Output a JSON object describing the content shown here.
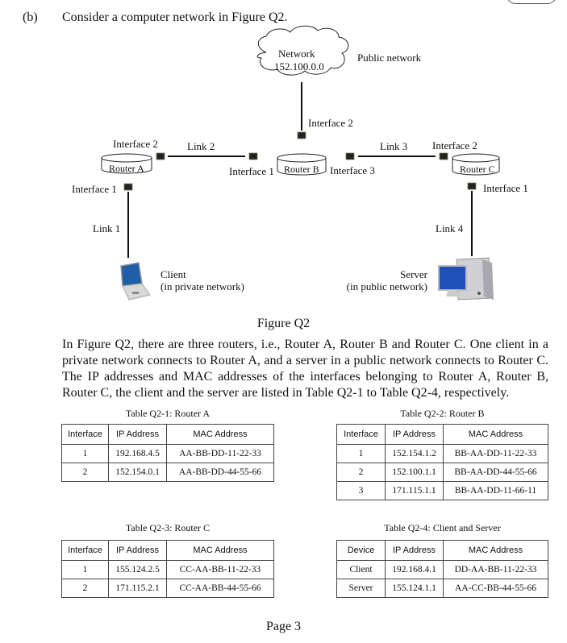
{
  "question": {
    "label": "(b)",
    "prompt": "Consider a computer network in Figure Q2."
  },
  "figure": {
    "caption": "Figure Q2",
    "network_cloud": {
      "line1": "Network",
      "line2": "152.100.0.0"
    },
    "public_network_label": "Public network",
    "routers": {
      "a": {
        "label": "Router A",
        "if1": "Interface 1",
        "if2": "Interface 2"
      },
      "b": {
        "label": "Router B",
        "if1": "Interface 1",
        "if2": "Interface 2",
        "if3": "Interface 3"
      },
      "c": {
        "label": "Router C",
        "if1": "Interface 1",
        "if2": "Interface 2"
      }
    },
    "links": {
      "l1": "Link 1",
      "l2": "Link 2",
      "l3": "Link 3",
      "l4": "Link 4"
    },
    "client": {
      "line1": "Client",
      "line2": "(in private network)"
    },
    "server": {
      "line1": "Server",
      "line2": "(in public network)"
    }
  },
  "paragraph": "In Figure Q2, there are three routers, i.e., Router A, Router B and Router C. One client in a private network connects to Router A, and a server in a public network connects to Router C. The IP addresses and MAC addresses of the interfaces belonging to Router A, Router B, Router C, the client and the server are listed in Table Q2-1 to Table Q2-4, respectively.",
  "tables": {
    "q2_1": {
      "caption": "Table Q2-1: Router A",
      "headers": [
        "Interface",
        "IP Address",
        "MAC Address"
      ],
      "rows": [
        [
          "1",
          "192.168.4.5",
          "AA-BB-DD-11-22-33"
        ],
        [
          "2",
          "152.154.0.1",
          "AA-BB-DD-44-55-66"
        ]
      ]
    },
    "q2_2": {
      "caption": "Table Q2-2: Router B",
      "headers": [
        "Interface",
        "IP Address",
        "MAC Address"
      ],
      "rows": [
        [
          "1",
          "152.154.1.2",
          "BB-AA-DD-11-22-33"
        ],
        [
          "2",
          "152.100.1.1",
          "BB-AA-DD-44-55-66"
        ],
        [
          "3",
          "171.115.1.1",
          "BB-AA-DD-11-66-11"
        ]
      ]
    },
    "q2_3": {
      "caption": "Table Q2-3: Router C",
      "headers": [
        "Interface",
        "IP Address",
        "MAC Address"
      ],
      "rows": [
        [
          "1",
          "155.124.2.5",
          "CC-AA-BB-11-22-33"
        ],
        [
          "2",
          "171.115.2.1",
          "CC-AA-BB-44-55-66"
        ]
      ]
    },
    "q2_4": {
      "caption": "Table Q2-4: Client and Server",
      "headers": [
        "Device",
        "IP Address",
        "MAC Address"
      ],
      "rows": [
        [
          "Client",
          "192.168.4.1",
          "DD-AA-BB-11-22-33"
        ],
        [
          "Server",
          "155.124.1.1",
          "AA-CC-BB-44-55-66"
        ]
      ]
    }
  },
  "footer": {
    "page": "Page 3"
  }
}
